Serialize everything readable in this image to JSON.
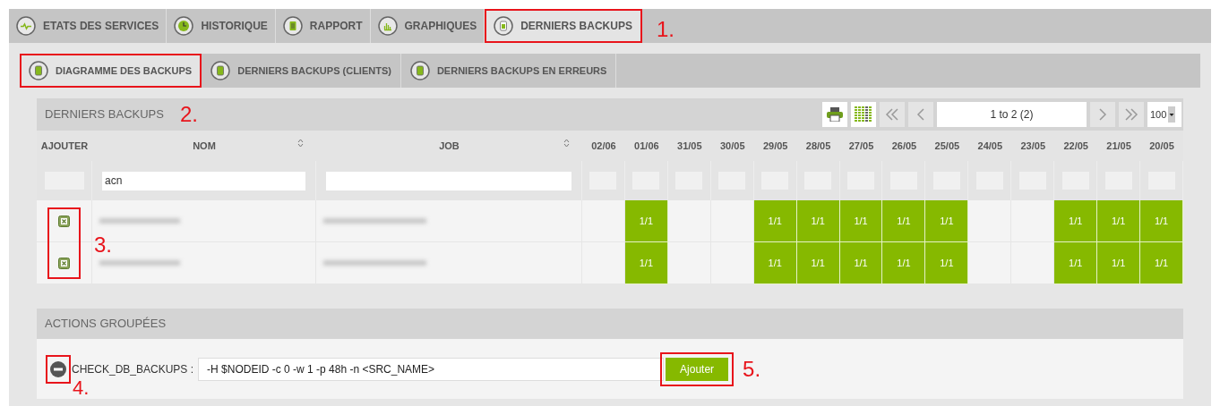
{
  "main_tabs": [
    {
      "label": "ETATS DES SERVICES",
      "selected": false,
      "annotated": false
    },
    {
      "label": "HISTORIQUE",
      "selected": false,
      "annotated": false
    },
    {
      "label": "RAPPORT",
      "selected": false,
      "annotated": false
    },
    {
      "label": "GRAPHIQUES",
      "selected": false,
      "annotated": false
    },
    {
      "label": "DERNIERS BACKUPS",
      "selected": true,
      "annotated": true
    }
  ],
  "main_tabs_annotation": "1.",
  "sub_tabs": [
    {
      "label": "DIAGRAMME DES BACKUPS",
      "selected": true,
      "annotated": true
    },
    {
      "label": "DERNIERS BACKUPS (CLIENTS)",
      "selected": false,
      "annotated": false
    },
    {
      "label": "DERNIERS BACKUPS EN ERREURS",
      "selected": false,
      "annotated": false
    }
  ],
  "panel": {
    "title": "DERNIERS BACKUPS",
    "annotation": "2.",
    "pager": {
      "range": "1 to 2 (2)",
      "page_size": "100"
    }
  },
  "table": {
    "columns": [
      "AJOUTER",
      "NOM",
      "JOB"
    ],
    "dates": [
      "02/06",
      "01/06",
      "31/05",
      "30/05",
      "29/05",
      "28/05",
      "27/05",
      "26/05",
      "25/05",
      "24/05",
      "23/05",
      "22/05",
      "21/05",
      "20/05"
    ],
    "name_filter": "acn",
    "checkbox_annotation": "3.",
    "rows": [
      {
        "results": [
          {
            "done": false
          },
          {
            "done": true,
            "text": "1/1"
          },
          {
            "done": false
          },
          {
            "done": false
          },
          {
            "done": true,
            "text": "1/1"
          },
          {
            "done": true,
            "text": "1/1"
          },
          {
            "done": true,
            "text": "1/1"
          },
          {
            "done": true,
            "text": "1/1"
          },
          {
            "done": true,
            "text": "1/1"
          },
          {
            "done": false
          },
          {
            "done": false
          },
          {
            "done": true,
            "text": "1/1"
          },
          {
            "done": true,
            "text": "1/1"
          },
          {
            "done": true,
            "text": "1/1"
          }
        ]
      },
      {
        "results": [
          {
            "done": false
          },
          {
            "done": true,
            "text": "1/1"
          },
          {
            "done": false
          },
          {
            "done": false
          },
          {
            "done": true,
            "text": "1/1"
          },
          {
            "done": true,
            "text": "1/1"
          },
          {
            "done": true,
            "text": "1/1"
          },
          {
            "done": true,
            "text": "1/1"
          },
          {
            "done": true,
            "text": "1/1"
          },
          {
            "done": false
          },
          {
            "done": false
          },
          {
            "done": true,
            "text": "1/1"
          },
          {
            "done": true,
            "text": "1/1"
          },
          {
            "done": true,
            "text": "1/1"
          }
        ]
      }
    ]
  },
  "actions": {
    "title": "ACTIONS GROUPÉES",
    "remove_annotated": true,
    "remove_annotation": "4.",
    "label": "CHECK_DB_BACKUPS :",
    "value": "-H $NODEID -c 0 -w 1 -p 48h -n <SRC_NAME>",
    "button": "Ajouter",
    "button_annotated": true,
    "button_annotation": "5."
  }
}
